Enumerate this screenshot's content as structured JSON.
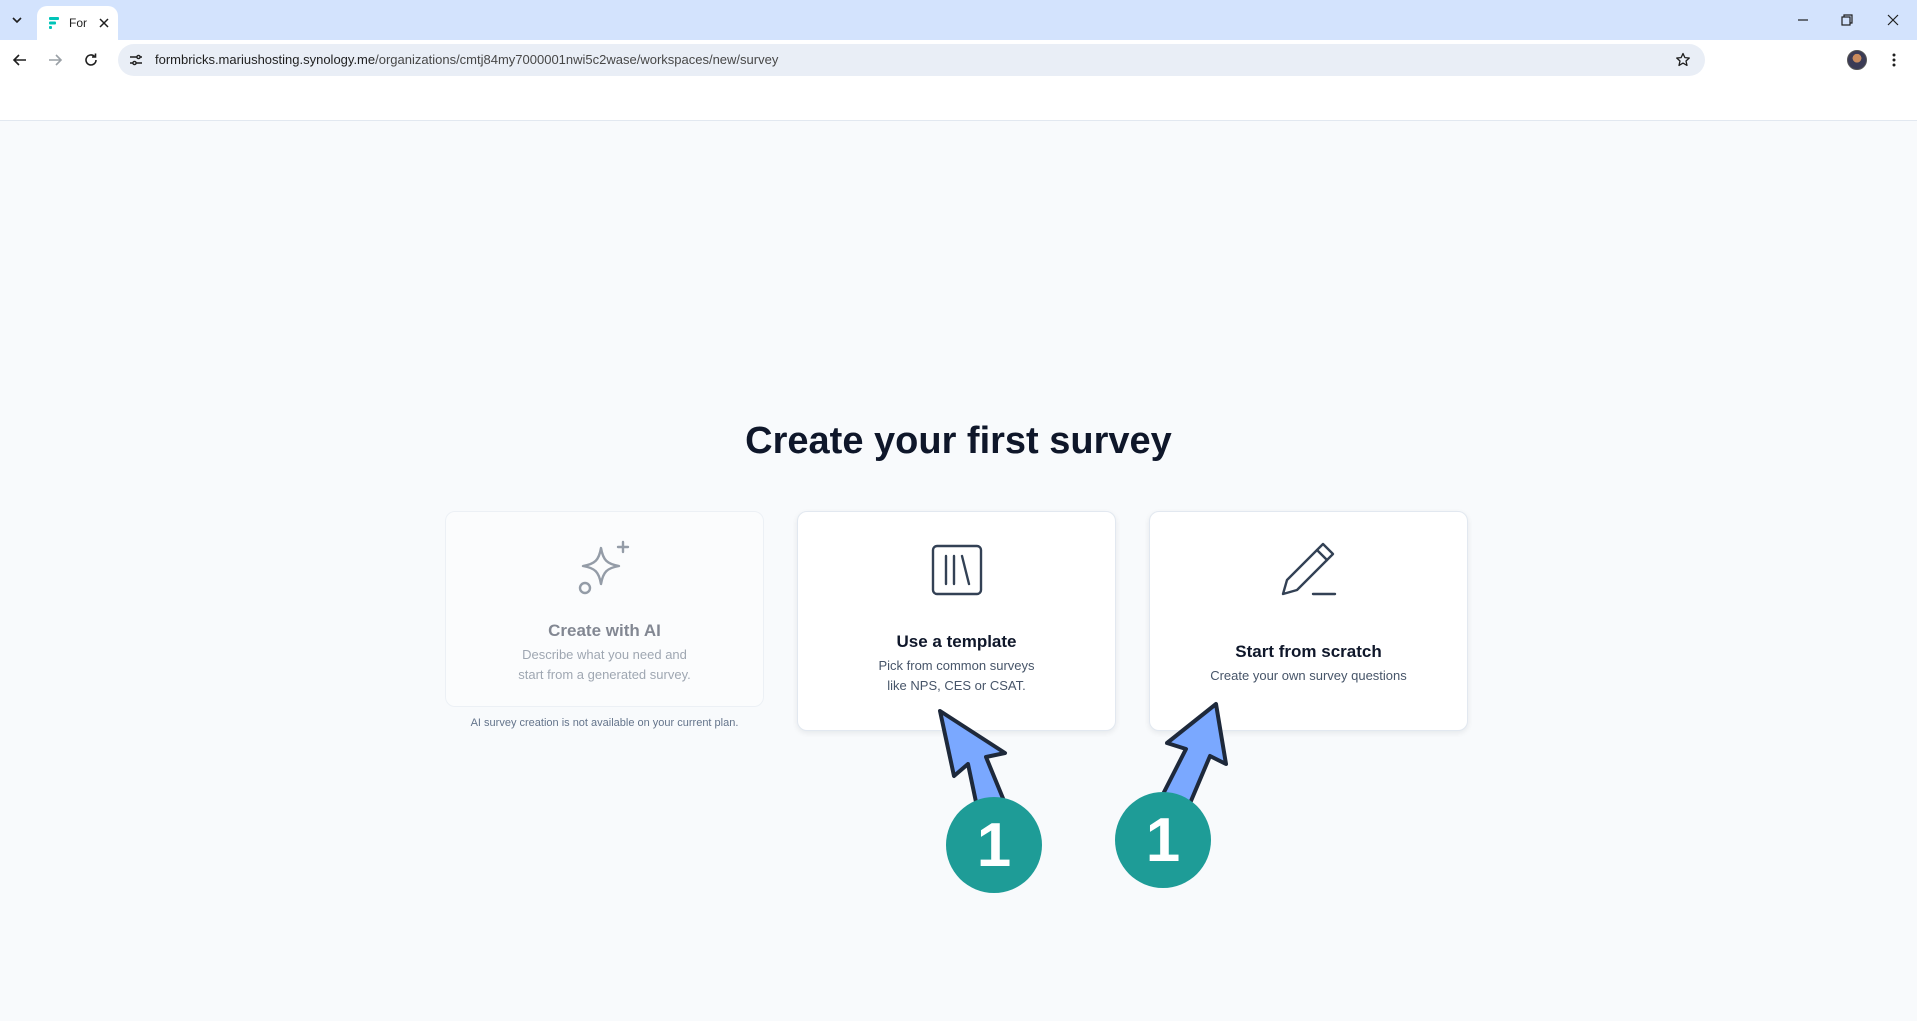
{
  "browser": {
    "tab_title": "For",
    "url_host": "formbricks.mariushosting.synology.me",
    "url_path": "/organizations/cmtj84my7000001nwi5c2wase/workspaces/new/survey"
  },
  "main": {
    "title": "Create your first survey",
    "cards": [
      {
        "title": "Create with AI",
        "desc_line1": "Describe what you need and",
        "desc_line2": "start from a generated survey.",
        "icon": "sparkles-icon",
        "disabled": true
      },
      {
        "title": "Use a template",
        "desc_line1": "Pick from common surveys",
        "desc_line2": "like NPS, CES or CSAT.",
        "icon": "library-icon"
      },
      {
        "title": "Start from scratch",
        "desc_line1": "Create your own survey questions",
        "icon": "pencil-icon"
      }
    ],
    "ai_note": "AI survey creation is not available on your current plan."
  },
  "annotations": {
    "badge_left": "1",
    "badge_right": "1",
    "arrow_color": "#7aa8ff",
    "badge_color": "#1e9c97"
  }
}
